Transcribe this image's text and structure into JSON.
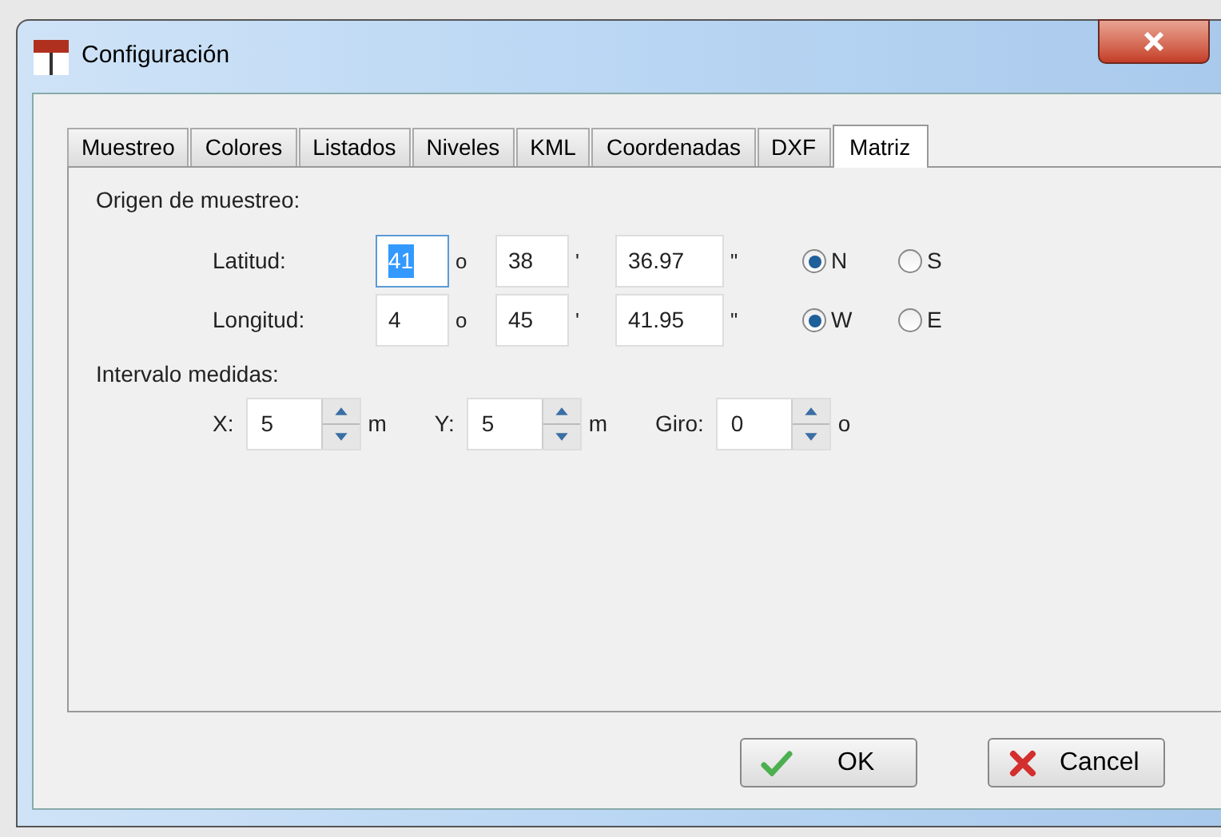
{
  "window": {
    "title": "Configuración"
  },
  "tabs": [
    {
      "label": "Muestreo",
      "selected": false
    },
    {
      "label": "Colores",
      "selected": false
    },
    {
      "label": "Listados",
      "selected": false
    },
    {
      "label": "Niveles",
      "selected": false
    },
    {
      "label": "KML",
      "selected": false
    },
    {
      "label": "Coordenadas",
      "selected": false
    },
    {
      "label": "DXF",
      "selected": false
    },
    {
      "label": "Matriz",
      "selected": true
    }
  ],
  "origin": {
    "title": "Origen de muestreo:",
    "rows": [
      {
        "label": "Latitud:",
        "fields": [
          {
            "value": "41",
            "unit": "o",
            "highlighted": true
          },
          {
            "value": "38",
            "unit": "'",
            "highlighted": false
          },
          {
            "value": "36.97",
            "unit": "\"",
            "highlighted": false
          }
        ],
        "options": [
          {
            "label": "N",
            "selected": true
          },
          {
            "label": "S",
            "selected": false
          }
        ]
      },
      {
        "label": "Longitud:",
        "fields": [
          {
            "value": "4",
            "unit": "o",
            "highlighted": false
          },
          {
            "value": "45",
            "unit": "'",
            "highlighted": false
          },
          {
            "value": "41.95",
            "unit": "\"",
            "highlighted": false
          }
        ],
        "options": [
          {
            "label": "W",
            "selected": true
          },
          {
            "label": "E",
            "selected": false
          }
        ]
      }
    ]
  },
  "interval": {
    "title": "Intervalo medidas:",
    "fields": [
      {
        "label": "X:",
        "value": "5",
        "unit": "m"
      },
      {
        "label": "Y:",
        "value": "5",
        "unit": "m"
      },
      {
        "label": "Giro:",
        "value": "0",
        "unit": "o"
      }
    ]
  },
  "buttons": [
    {
      "label": "OK",
      "kind": "ok"
    },
    {
      "label": "Cancel",
      "kind": "cancel"
    }
  ]
}
